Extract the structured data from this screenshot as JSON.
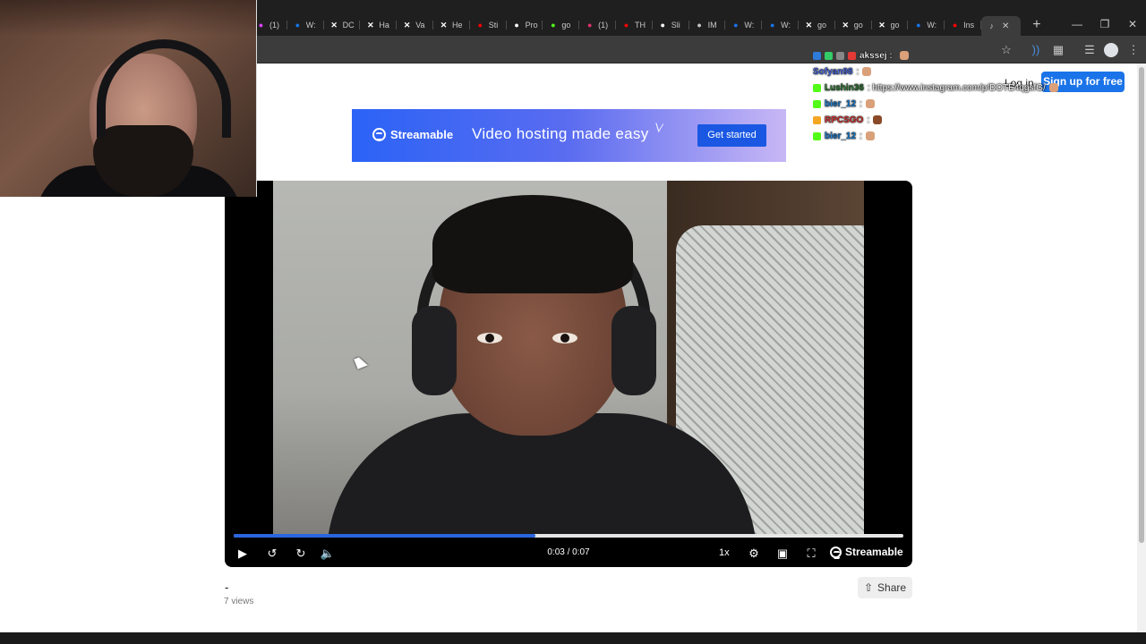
{
  "browser": {
    "tabs": [
      {
        "title": "(1)",
        "icon": "notification-icon",
        "color": "#e040fb"
      },
      {
        "title": "W:",
        "icon": "streamable-icon",
        "color": "#1a73e8"
      },
      {
        "title": "DC",
        "icon": "x-icon",
        "color": "#ffffff"
      },
      {
        "title": "Ha",
        "icon": "x-icon",
        "color": "#ffffff"
      },
      {
        "title": "Va",
        "icon": "x-icon",
        "color": "#ffffff"
      },
      {
        "title": "He",
        "icon": "x-icon",
        "color": "#ffffff"
      },
      {
        "title": "Sti",
        "icon": "youtube-icon",
        "color": "#ff0000"
      },
      {
        "title": "Pro",
        "icon": "tiktok-icon",
        "color": "#ffffff"
      },
      {
        "title": "go",
        "icon": "kick-icon",
        "color": "#53fc18"
      },
      {
        "title": "(1)",
        "icon": "instagram-icon",
        "color": "#e1306c"
      },
      {
        "title": "TH",
        "icon": "youtube-icon",
        "color": "#ff0000"
      },
      {
        "title": "Sli",
        "icon": "app-icon",
        "color": "#ffffff"
      },
      {
        "title": "IM",
        "icon": "globe-icon",
        "color": "#c7c7c7"
      },
      {
        "title": "W:",
        "icon": "streamable-icon",
        "color": "#1a73e8"
      },
      {
        "title": "W:",
        "icon": "streamable-icon",
        "color": "#1a73e8"
      },
      {
        "title": "go",
        "icon": "x-icon",
        "color": "#ffffff"
      },
      {
        "title": "go",
        "icon": "x-icon",
        "color": "#ffffff"
      },
      {
        "title": "go",
        "icon": "x-icon",
        "color": "#ffffff"
      },
      {
        "title": "W:",
        "icon": "streamable-icon",
        "color": "#1a73e8"
      },
      {
        "title": "Ins",
        "icon": "youtube-icon",
        "color": "#ff0000"
      }
    ],
    "active_tab_icon": "speaker-icon"
  },
  "header": {
    "login_label": "Log in",
    "signup_label": "Sign up for free"
  },
  "banner": {
    "brand": "Streamable",
    "tagline": "Video hosting made easy",
    "cta": "Get started"
  },
  "player": {
    "time": "0:03 / 0:07",
    "progress": 0.45,
    "speed": "1x",
    "brand": "Streamable"
  },
  "video": {
    "title": "-",
    "views": "7 views",
    "share_label": "Share"
  },
  "chat": [
    {
      "user": "akssej :",
      "user_color": "#ffffff",
      "message": "",
      "badges": [
        "#2f7bd8",
        "#33cc66",
        "#888888",
        "#e53935"
      ]
    },
    {
      "user": "Sofyan98",
      "user_color": "#4c6ef5",
      "message": ":",
      "badges": []
    },
    {
      "user": "Lushin36",
      "user_color": "#2e7d32",
      "message": ": https://www.instagram.com/p/DOTE4qgsfG/",
      "badges": [
        "#53fc18"
      ]
    },
    {
      "user": "bier_12",
      "user_color": "#1e88e5",
      "message": ":",
      "badges": [
        "#53fc18"
      ]
    },
    {
      "user": "RPCSGO",
      "user_color": "#e53935",
      "message": ":",
      "badges": [
        "#f5a623"
      ]
    },
    {
      "user": "bier_12",
      "user_color": "#1e88e5",
      "message": ":",
      "badges": [
        "#53fc18"
      ]
    }
  ]
}
